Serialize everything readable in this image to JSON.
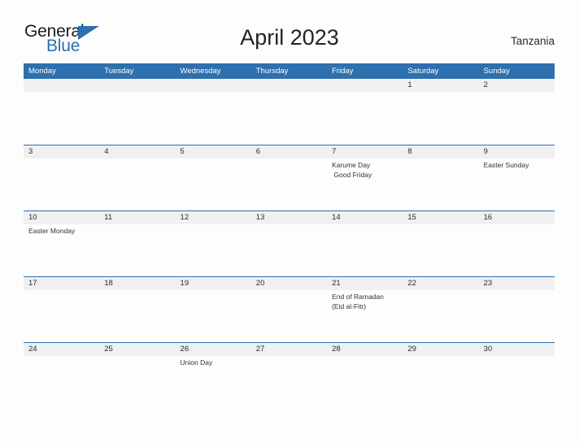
{
  "brand": {
    "word_one": "General",
    "word_two": "Blue",
    "accent_color": "#2d6fb0"
  },
  "header": {
    "title": "April 2023",
    "country": "Tanzania"
  },
  "theme": {
    "header_bar_color": "#2e70ae",
    "daynum_band_color": "#f0f0f0",
    "row_divider_color": "#2d6fb0",
    "page_background": "#fdfdfd"
  },
  "weekdays": [
    "Monday",
    "Tuesday",
    "Wednesday",
    "Thursday",
    "Friday",
    "Saturday",
    "Sunday"
  ],
  "weeks": [
    [
      {
        "day": "",
        "events": []
      },
      {
        "day": "",
        "events": []
      },
      {
        "day": "",
        "events": []
      },
      {
        "day": "",
        "events": []
      },
      {
        "day": "",
        "events": []
      },
      {
        "day": "1",
        "events": []
      },
      {
        "day": "2",
        "events": []
      }
    ],
    [
      {
        "day": "3",
        "events": []
      },
      {
        "day": "4",
        "events": []
      },
      {
        "day": "5",
        "events": []
      },
      {
        "day": "6",
        "events": []
      },
      {
        "day": "7",
        "events": [
          "Karume Day",
          " Good Friday"
        ]
      },
      {
        "day": "8",
        "events": []
      },
      {
        "day": "9",
        "events": [
          "Easter Sunday"
        ]
      }
    ],
    [
      {
        "day": "10",
        "events": [
          "Easter Monday"
        ]
      },
      {
        "day": "11",
        "events": []
      },
      {
        "day": "12",
        "events": []
      },
      {
        "day": "13",
        "events": []
      },
      {
        "day": "14",
        "events": []
      },
      {
        "day": "15",
        "events": []
      },
      {
        "day": "16",
        "events": []
      }
    ],
    [
      {
        "day": "17",
        "events": []
      },
      {
        "day": "18",
        "events": []
      },
      {
        "day": "19",
        "events": []
      },
      {
        "day": "20",
        "events": []
      },
      {
        "day": "21",
        "events": [
          "End of Ramadan",
          "(Eid al-Fitr)"
        ]
      },
      {
        "day": "22",
        "events": []
      },
      {
        "day": "23",
        "events": []
      }
    ],
    [
      {
        "day": "24",
        "events": []
      },
      {
        "day": "25",
        "events": []
      },
      {
        "day": "26",
        "events": [
          "Union Day"
        ]
      },
      {
        "day": "27",
        "events": []
      },
      {
        "day": "28",
        "events": []
      },
      {
        "day": "29",
        "events": []
      },
      {
        "day": "30",
        "events": []
      }
    ]
  ]
}
